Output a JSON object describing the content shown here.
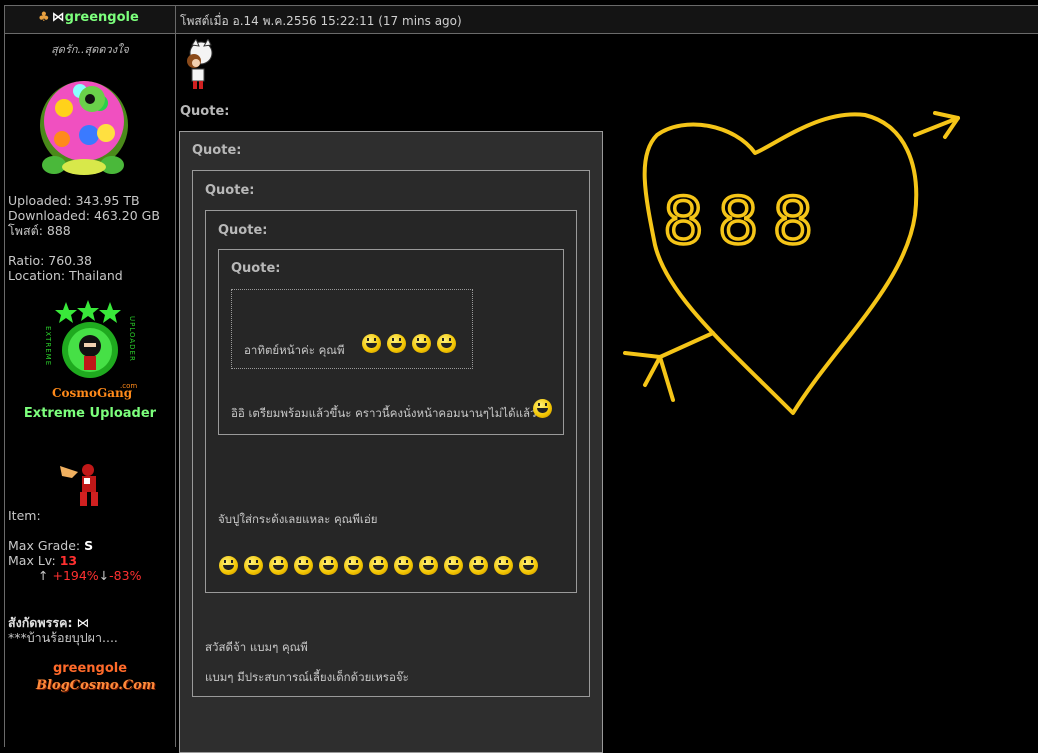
{
  "post": {
    "username": "greengole",
    "posted_at": "โพสต์เมื่อ อ.14 พ.ค.2556 15:22:11 (17 mins ago)"
  },
  "profile": {
    "tagline": "สุดรัก..สุดดวงใจ",
    "uploaded": "Uploaded: 343.95 TB",
    "downloaded": "Downloaded: 463.20 GB",
    "posts": "โพสต์: 888",
    "ratio": "Ratio: 760.38",
    "location": "Location: Thailand",
    "rank_badge_text": "CosmoGang",
    "rank_badge_side_left": "EXTREME",
    "rank_badge_side_right": "UPLOADER",
    "rank_badge_com": ".com",
    "rank": "Extreme Uploader",
    "item_label": "Item:",
    "max_grade_label": "Max Grade:",
    "max_grade_value": "S",
    "max_lv_label": "Max Lv:",
    "max_lv_value": "13",
    "up_arrow": "↑",
    "up_pct": "+194%",
    "down_arrow": "↓",
    "down_pct": "-83%",
    "gang_label": "สังกัดพรรค:",
    "gang_name": "***บ้านร้อยบุปผา....",
    "sig_name": "greengole",
    "sig_blog": "BlogCosmo.Com"
  },
  "quotes": {
    "label": "Quote:",
    "innermost_text": "อาทิตย์หน้าค่ะ คุณพี",
    "level4_text": "อิอิ เตรียมพร้อมแล้วขึ้นะ คราวนี้คงนั่งหน้าคอมนานๆไม่ได้แล้วซิ",
    "level3_text": "จับปูใส่กระด้งเลยแหละ คุณพีเอ่ย",
    "level2_line1": "สวัสดีจ้า  แบมๆ คุณพี",
    "level2_line2": "แบมๆ มีประสบการณ์เลี้ยงเด็กด้วยเหรอจ๊ะ",
    "innermost_smileys": 4,
    "level3_smileys": 13
  },
  "drawing": {
    "text": "888",
    "color": "#f5c518"
  }
}
